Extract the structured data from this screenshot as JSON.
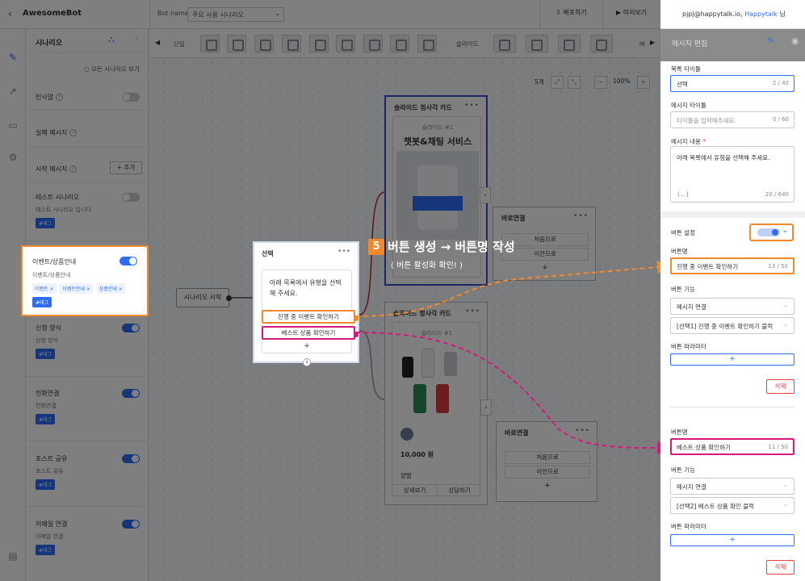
{
  "topbar": {
    "brand": "AwesomeBot",
    "bot_label": "Bot name",
    "bot_value": "주요 사용 시나리오",
    "deploy": "배포하기",
    "preview": "미리보기",
    "user_email": "pjpj@happytalk.io, ",
    "user_org": "Happytalk",
    "user_suffix": " 님"
  },
  "scenario": {
    "title": "시나리오",
    "view_all": "모든 시나리오 보기",
    "greeting": "인사말",
    "fail_message": "실패 메시지",
    "start_message": "시작 메시지",
    "add_label": "+ 추가",
    "items": [
      {
        "name": "테스트 시나리오",
        "desc": "테스트 시나리오 입니다.",
        "tag": "#태그"
      },
      {
        "name": "신청 양식",
        "desc": "신청 양식",
        "tag": "#태그"
      },
      {
        "name": "전화연결",
        "desc": "전화연결",
        "tag": "#태그"
      },
      {
        "name": "포스트 공유",
        "desc": "포스트 공유",
        "tag": "#태그"
      },
      {
        "name": "이메일 연결",
        "desc": "이메일 연결",
        "tag": "#태그"
      }
    ],
    "highlighted": {
      "name": "이벤트/상품안내",
      "desc": "이벤트/상품안내",
      "chips": [
        "이벤트",
        "이벤트안내",
        "상품안내"
      ],
      "tag": "#태그"
    }
  },
  "toolbar": {
    "single": "단일",
    "slide": "슬라이드",
    "right_cut": "버"
  },
  "canvas": {
    "count": "5개",
    "zoom": "100%",
    "start_node": "시나리오 시작",
    "card1_title": "슬라이드 정사각 카드",
    "card1_slide": "슬라이드 #1",
    "card1_banner": "챗봇&채팅 서비스",
    "card2_title": "슬라이드 정사각 카드",
    "card2_slide": "슬라이드 #1",
    "card2_price": "10,000 원",
    "card2_desc": "양말",
    "card2_btn1": "상세보기",
    "card2_btn2": "상담하기",
    "shortcut1_title": "바로연결",
    "shortcut1_btn1": "처음으로",
    "shortcut1_btn2": "이전으로",
    "shortcut2_title": "바로연결",
    "shortcut2_btn1": "처음으로",
    "shortcut2_btn2": "이전으로",
    "select_node": {
      "title": "선택",
      "message": "아래 목록에서 유형을 선택해 주세요.",
      "button1": "진행 중 이벤트 확인하기",
      "button2": "베스트 상품 확인하기",
      "plus": "+"
    }
  },
  "callout": {
    "number": "5",
    "text": "버튼 생성 → 버튼명 작성",
    "sub": "( 버튼 활성화 확인! )"
  },
  "panel": {
    "title": "메시지 편집",
    "list_title_label": "목록 타이틀",
    "list_title_value": "선택",
    "list_title_count": "2 / 40",
    "msg_title_label": "메시지 타이틀",
    "msg_title_placeholder": "타이틀을 입력해주세요.",
    "msg_title_count": "0 / 60",
    "msg_content_label": "메시지 내용",
    "msg_content_req": "*",
    "msg_content_value": "아래 목록에서 유형을 선택해 주세요.",
    "msg_content_br": "{...}",
    "msg_content_count": "20 / 640",
    "button_setting_label": "버튼 설정",
    "buttons": [
      {
        "name_label": "버튼명",
        "name_value": "진행 중 이벤트 확인하기",
        "name_count": "13 / 50",
        "func_label": "버튼 기능",
        "func_value": "메시지 연결",
        "target_value": "[선택1] 진행 중 이벤트 확인하기 블럭",
        "param_label": "버튼 파라미터",
        "plus": "+",
        "delete": "삭제"
      },
      {
        "name_label": "버튼명",
        "name_value": "베스트 상품 확인하기",
        "name_count": "11 / 50",
        "func_label": "버튼 기능",
        "func_value": "메시지 연결",
        "target_value": "[선택2] 베스트 상품 확인 블럭",
        "param_label": "버튼 파라미터",
        "plus": "+",
        "delete": "삭제"
      }
    ]
  },
  "colors": {
    "accent": "#2d6df6",
    "orange": "#f08a2c",
    "pink": "#d6197d"
  }
}
